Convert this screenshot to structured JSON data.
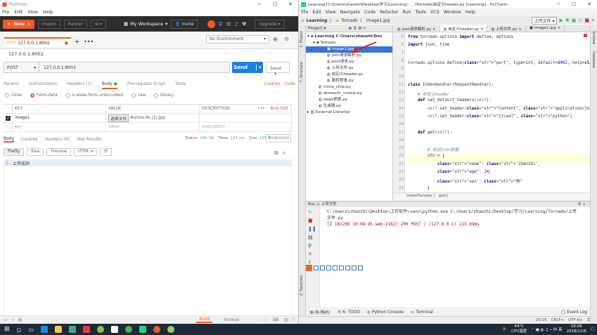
{
  "postman": {
    "title": "Postman",
    "menu": [
      "File",
      "Edit",
      "View",
      "Help"
    ],
    "toolbar": {
      "new": "New",
      "import": "Import",
      "runner": "Runner",
      "workspace": "My Workspace",
      "invite": "Invite",
      "upgrade": "Upgrade"
    },
    "tab_url": "127.0.0.1:8002",
    "env": "No Environment",
    "request_name": "127.0.0.1:8002",
    "method": "POST",
    "url": "127.0.0.1:8002",
    "send": "Send",
    "save": "Save",
    "subtabs": [
      "Params",
      "Authorization",
      "Headers (1)",
      "Body",
      "Pre-request Script",
      "Tests"
    ],
    "cookies": "Cookies",
    "code": "Code",
    "body_types": [
      "none",
      "form-data",
      "x-www-form-urlencoded",
      "raw",
      "binary"
    ],
    "kv_headers": [
      "KEY",
      "VALUE",
      "DESCRIPTION"
    ],
    "bulk_edit": "Bulk Edit",
    "row1": {
      "key": "image1",
      "choose": "选择文件",
      "file": "Aurora-4k (1).jpg"
    },
    "row_placeholder": {
      "key": "Key",
      "value": "Value",
      "description": "Description"
    },
    "resp_tabs": [
      "Body",
      "Cookies",
      "Headers (4)",
      "Test Results"
    ],
    "status": {
      "label": "Status:",
      "value": "200 OK",
      "time_label": "Time:",
      "time": "131 ms",
      "size_label": "Size:",
      "size": "155 B"
    },
    "download": "Download",
    "views": [
      "Pretty",
      "Raw",
      "Preview",
      "HTML"
    ],
    "response_line": "上传成功",
    "response_line_no": "1",
    "bottom": {
      "build": "Build",
      "browse": "Browse"
    }
  },
  "pycharm": {
    "title": "Learning [C:\\Users\\zhaozhi\\Desktop\\学习\\Learning] - ...\\Tornado\\自定义header.py [Learning] - PyCharm",
    "menu": [
      "File",
      "Edit",
      "View",
      "Navigate",
      "Code",
      "Refactor",
      "Run",
      "Tools",
      "VCS",
      "Window",
      "Help"
    ],
    "breadcrumb": [
      "Learning",
      "Tornado",
      "image1.jpg"
    ],
    "run_config": "上传文件",
    "project_label": "Project",
    "tree": [
      {
        "text": "Learning C:\\Users\\zhaozhi\\Des",
        "indent": 0
      },
      {
        "text": "Tornado",
        "indent": 1
      },
      {
        "text": "image1.jpg",
        "indent": 3,
        "selected": true
      },
      {
        "text": "json请求解析.py",
        "indent": 3
      },
      {
        "text": "post请求.py",
        "indent": 3
      },
      {
        "text": "上传文件.py",
        "indent": 3
      },
      {
        "text": "自定义header.py",
        "indent": 3
      },
      {
        "text": "跳转登录.py",
        "indent": 3
      },
      {
        "text": "china_ctrip.py",
        "indent": 2
      },
      {
        "text": "domestic_cookie.py",
        "indent": 2
      },
      {
        "text": "news抓数.py",
        "indent": 2
      },
      {
        "text": "生成器.py",
        "indent": 2
      },
      {
        "text": "External Libraries",
        "indent": 0
      }
    ],
    "editor_tabs": [
      "json请求解析.py",
      "自定义header.py",
      "上传文件.py",
      "image1.jpg"
    ],
    "active_tab": 1,
    "code_lines": [
      {
        "n": "5",
        "t": "from tornado.options import define, options"
      },
      {
        "n": "6",
        "t": "import json, time"
      },
      {
        "n": "7",
        "t": ""
      },
      {
        "n": "8",
        "t": "tornado.options.define(\"port\", type=int, default=8002, help=\"服务器窗户端\")"
      },
      {
        "n": "9",
        "t": ""
      },
      {
        "n": "10",
        "t": ""
      },
      {
        "n": "11",
        "t": "class IndexHandler(RequestHandler):"
      },
      {
        "n": "12",
        "t": "    # 自定义header"
      },
      {
        "n": "13",
        "t": "    def set_default_headers(self):"
      },
      {
        "n": "14",
        "t": "        self.set_header(\"Content\", \"application/json; charset=UTF-8\")"
      },
      {
        "n": "15",
        "t": "        self.set_header(\"itcast\", \"python\")"
      },
      {
        "n": "16",
        "t": ""
      },
      {
        "n": "17",
        "t": "    def get(self):"
      },
      {
        "n": "18",
        "t": ""
      },
      {
        "n": "19",
        "t": "        # 返回json数据"
      },
      {
        "n": "20",
        "t": "        stu = {"
      },
      {
        "n": "21",
        "t": "            \"name\": 'zhaozhi',"
      },
      {
        "n": "22",
        "t": "            \"age\": 24,"
      },
      {
        "n": "23",
        "t": "            'sex': \"男\""
      },
      {
        "n": "24",
        "t": "        }"
      }
    ],
    "editor_breadcrumb": "IndexHandler  〉 get()",
    "run_label": "Run",
    "run_tab": "上传文件",
    "run_output": [
      "C:\\Users\\zhaozhi\\Desktop\\工作软件\\venv\\python.exe C:/Users/zhaozhi/Desktop/学习/Learning/Tornado/上传",
      "  文件.py",
      "[I 181206 10:08:45 web:2162] 200 POST / (127.0.0.1) 115.69ms"
    ],
    "bottom_tabs": [
      "4: Run",
      "6: TODO",
      "Python Console",
      "Terminal"
    ],
    "event_log": "Event Log",
    "statusbar": [
      "20:16",
      "CRLF+",
      "UTF-8+"
    ]
  },
  "taskbar": {
    "temp": "44°C",
    "cpu": "CPU温度",
    "time": "10:09",
    "date": "2018/12/6"
  },
  "colors": {
    "postman_orange": "#ef5b25",
    "send_blue": "#1a7ee7",
    "selection": "#3875d7"
  }
}
